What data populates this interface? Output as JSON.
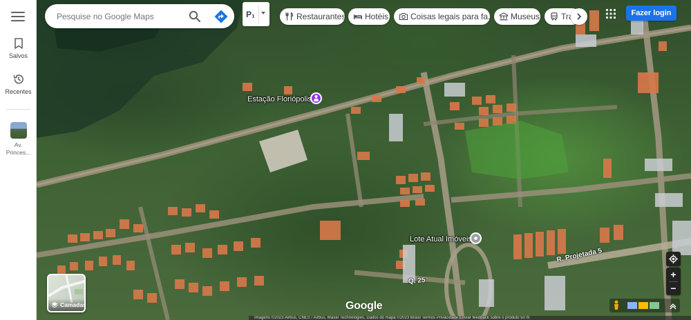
{
  "rail": {
    "saved_label": "Salvos",
    "recent_label": "Recentes",
    "place_label_line1": "Av.",
    "place_label_line2": "Princes..."
  },
  "search": {
    "placeholder": "Pesquise no Google Maps"
  },
  "route_chip": {
    "label": "P₁"
  },
  "chips": [
    {
      "label": "Restaurantes",
      "icon": "fork-knife-icon"
    },
    {
      "label": "Hotéis",
      "icon": "bed-icon"
    },
    {
      "label": "Coisas legais para fa...",
      "icon": "camera-icon"
    },
    {
      "label": "Museus",
      "icon": "museum-icon"
    },
    {
      "label": "Tra...",
      "icon": "train-icon"
    }
  ],
  "login_label": "Fazer login",
  "map": {
    "poi_1": "Estação Floriópolis",
    "poi_2": "Lote Atual Imóveis",
    "street_1": "R. Projetada 5",
    "street_2": "Q. 25"
  },
  "layers_label": "Camadas",
  "google_logo": "Google",
  "attribution": "Imagens ©2023 Airbus, CNES / Airbus, Maxar Technologies, Dados do mapa ©2023    Brasil    Termos    Privacidade    Enviar feedback sobre o produto    50 m",
  "colors": {
    "accent": "#1a73e8",
    "poi_purple": "#9334e6",
    "poi_gray": "#9aa0a6"
  }
}
